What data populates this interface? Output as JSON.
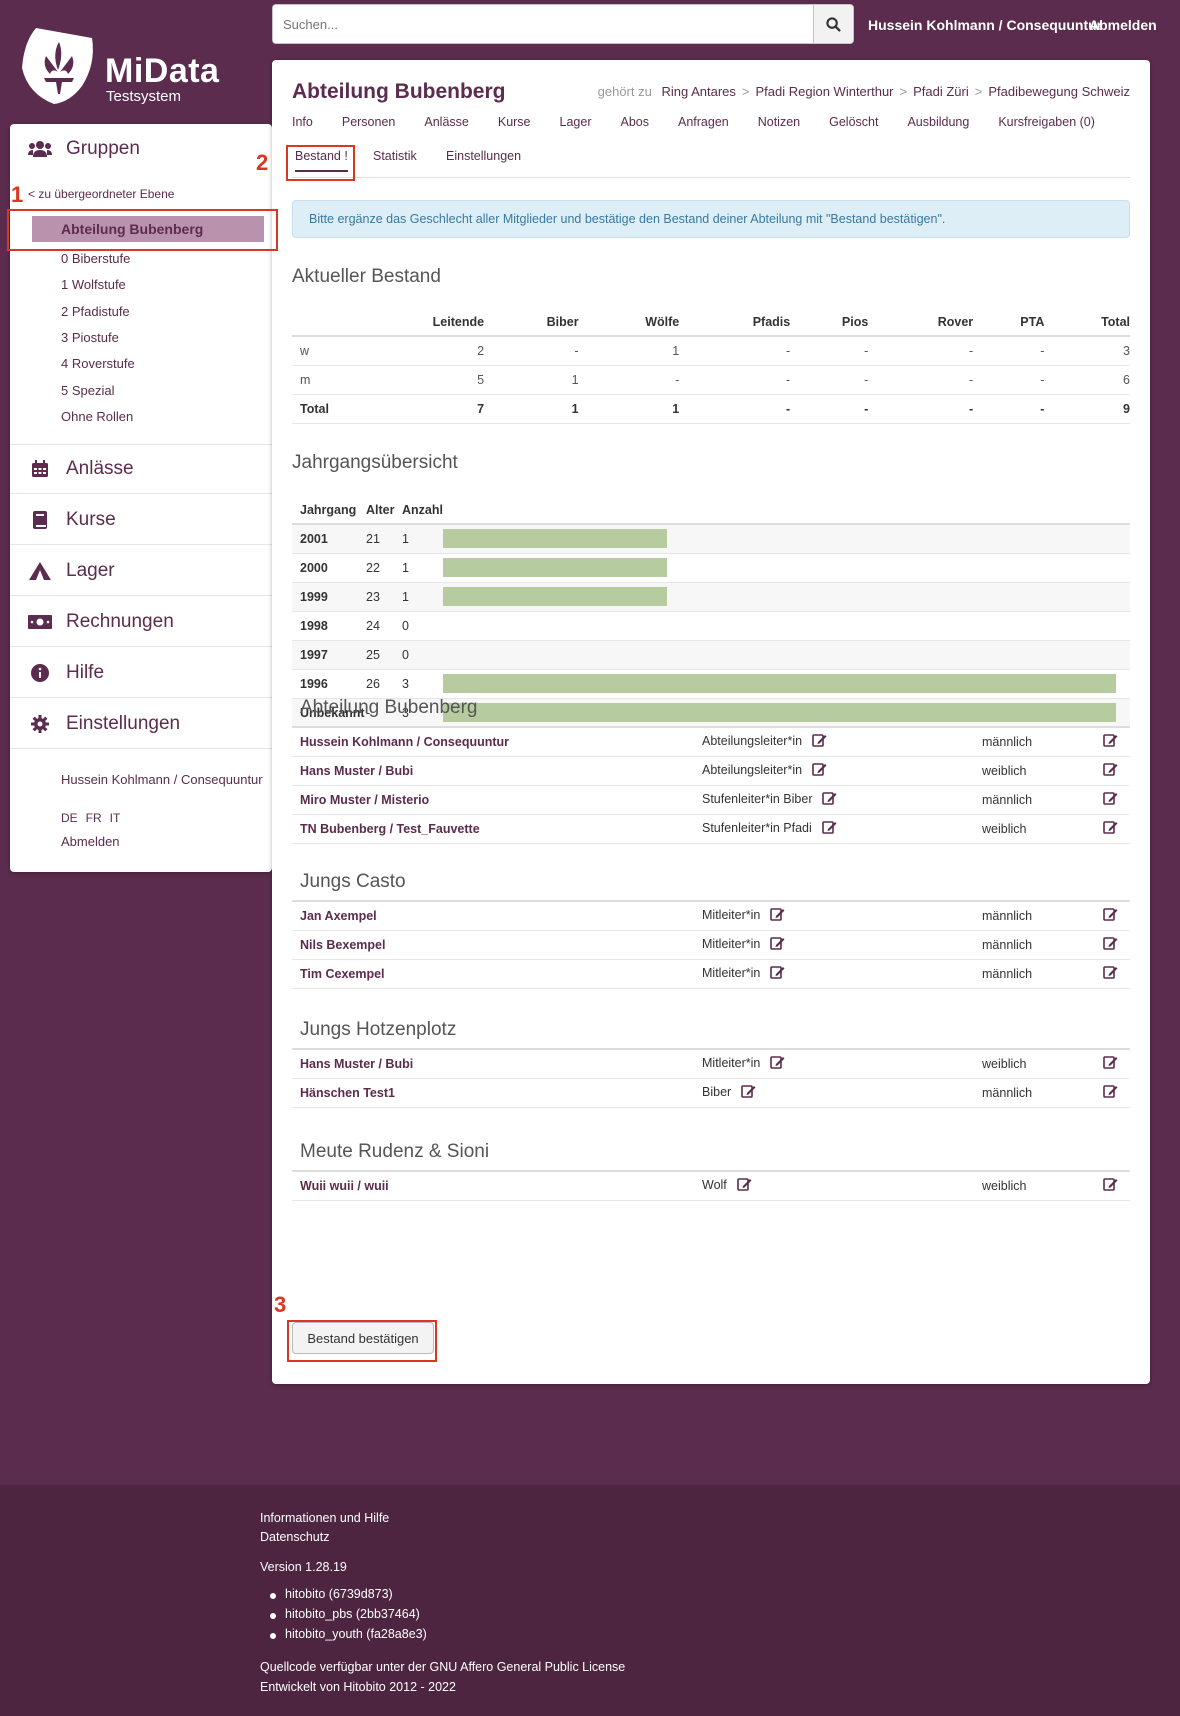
{
  "app": {
    "name": "MiData",
    "subtitle": "Testsystem"
  },
  "topbar": {
    "search_placeholder": "Suchen...",
    "user": "Hussein Kohlmann / Consequuntur",
    "logout": "Abmelden"
  },
  "sidebar": {
    "groups_label": "Gruppen",
    "parent_link": "< zu übergeordneter Ebene",
    "current": "Abteilung Bubenberg",
    "subgroups": [
      "0 Biberstufe",
      "1 Wolfstufe",
      "2 Pfadistufe",
      "3 Piostufe",
      "4 Roverstufe",
      "5 Spezial",
      "Ohne Rollen"
    ],
    "nav": [
      {
        "label": "Anlässe",
        "icon": "calendar-icon"
      },
      {
        "label": "Kurse",
        "icon": "book-icon"
      },
      {
        "label": "Lager",
        "icon": "tent-icon"
      },
      {
        "label": "Rechnungen",
        "icon": "money-icon"
      },
      {
        "label": "Hilfe",
        "icon": "info-icon"
      },
      {
        "label": "Einstellungen",
        "icon": "gear-icon"
      }
    ],
    "user": "Hussein Kohlmann / Consequuntur",
    "langs": [
      "DE",
      "FR",
      "IT"
    ],
    "logout": "Abmelden"
  },
  "page": {
    "title": "Abteilung Bubenberg",
    "breadcrumb_prefix": "gehört zu",
    "breadcrumb": [
      "Ring Antares",
      "Pfadi Region Winterthur",
      "Pfadi Züri",
      "Pfadibewegung Schweiz"
    ],
    "tabs": [
      "Info",
      "Personen",
      "Anlässe",
      "Kurse",
      "Lager",
      "Abos",
      "Anfragen",
      "Notizen",
      "Gelöscht",
      "Ausbildung",
      "Kursfreigaben (0)"
    ],
    "subtabs": [
      "Bestand !",
      "Statistik",
      "Einstellungen"
    ],
    "alert": "Bitte ergänze das Geschlecht aller Mitglieder und bestätige den Bestand deiner Abteilung mit \"Bestand bestätigen\"."
  },
  "bestand": {
    "title": "Aktueller Bestand",
    "headers": [
      "",
      "Leitende",
      "Biber",
      "Wölfe",
      "Pfadis",
      "Pios",
      "Rover",
      "PTA",
      "Total"
    ],
    "rows": [
      [
        "w",
        "2",
        "-",
        "1",
        "-",
        "-",
        "-",
        "-",
        "3"
      ],
      [
        "m",
        "5",
        "1",
        "-",
        "-",
        "-",
        "-",
        "-",
        "6"
      ],
      [
        "Total",
        "7",
        "1",
        "1",
        "-",
        "-",
        "-",
        "-",
        "9"
      ]
    ]
  },
  "jahrgang": {
    "title": "Jahrgangsübersicht",
    "headers": [
      "Jahrgang",
      "Alter",
      "Anzahl"
    ],
    "max": 3,
    "rows": [
      {
        "year": "2001",
        "age": "21",
        "count": 1
      },
      {
        "year": "2000",
        "age": "22",
        "count": 1
      },
      {
        "year": "1999",
        "age": "23",
        "count": 1
      },
      {
        "year": "1998",
        "age": "24",
        "count": 0
      },
      {
        "year": "1997",
        "age": "25",
        "count": 0
      },
      {
        "year": "1996",
        "age": "26",
        "count": 3
      },
      {
        "year": "Unbekannt",
        "age": "-",
        "count": 3
      }
    ]
  },
  "groups": [
    {
      "title": "Abteilung Bubenberg",
      "people": [
        {
          "name": "Hussein Kohlmann / Consequuntur",
          "role": "Abteilungsleiter*in",
          "gender": "männlich"
        },
        {
          "name": "Hans Muster / Bubi",
          "role": "Abteilungsleiter*in",
          "gender": "weiblich"
        },
        {
          "name": "Miro Muster / Misterio",
          "role": "Stufenleiter*in Biber",
          "gender": "männlich"
        },
        {
          "name": "TN Bubenberg / Test_Fauvette",
          "role": "Stufenleiter*in Pfadi",
          "gender": "weiblich"
        }
      ]
    },
    {
      "title": "Jungs Casto",
      "people": [
        {
          "name": "Jan Axempel",
          "role": "Mitleiter*in",
          "gender": "männlich"
        },
        {
          "name": "Nils Bexempel",
          "role": "Mitleiter*in",
          "gender": "männlich"
        },
        {
          "name": "Tim Cexempel",
          "role": "Mitleiter*in",
          "gender": "männlich"
        }
      ]
    },
    {
      "title": "Jungs Hotzenplotz",
      "people": [
        {
          "name": "Hans Muster / Bubi",
          "role": "Mitleiter*in",
          "gender": "weiblich"
        },
        {
          "name": "Hänschen Test1",
          "role": "Biber",
          "gender": "männlich"
        }
      ]
    },
    {
      "title": "Meute Rudenz & Sioni",
      "people": [
        {
          "name": "Wuii wuii / wuii",
          "role": "Wolf",
          "gender": "weiblich"
        }
      ]
    }
  ],
  "confirm_button": "Bestand bestätigen",
  "callouts": [
    "1",
    "2",
    "3"
  ],
  "footer": {
    "info": "Informationen und Hilfe",
    "privacy": "Datenschutz",
    "version": "Version 1.28.19",
    "components": [
      "hitobito (6739d873)",
      "hitobito_pbs (2bb37464)",
      "hitobito_youth (fa28a8e3)"
    ],
    "license": "Quellcode verfügbar unter der GNU Affero General Public License",
    "developed": "Entwickelt von Hitobito 2012 - 2022"
  },
  "colors": {
    "brand": "#5b2c4d",
    "active_group": "#b993ae",
    "bar": "#b7cba0",
    "callout": "#d9371f",
    "alert_bg": "#ddeef7"
  }
}
